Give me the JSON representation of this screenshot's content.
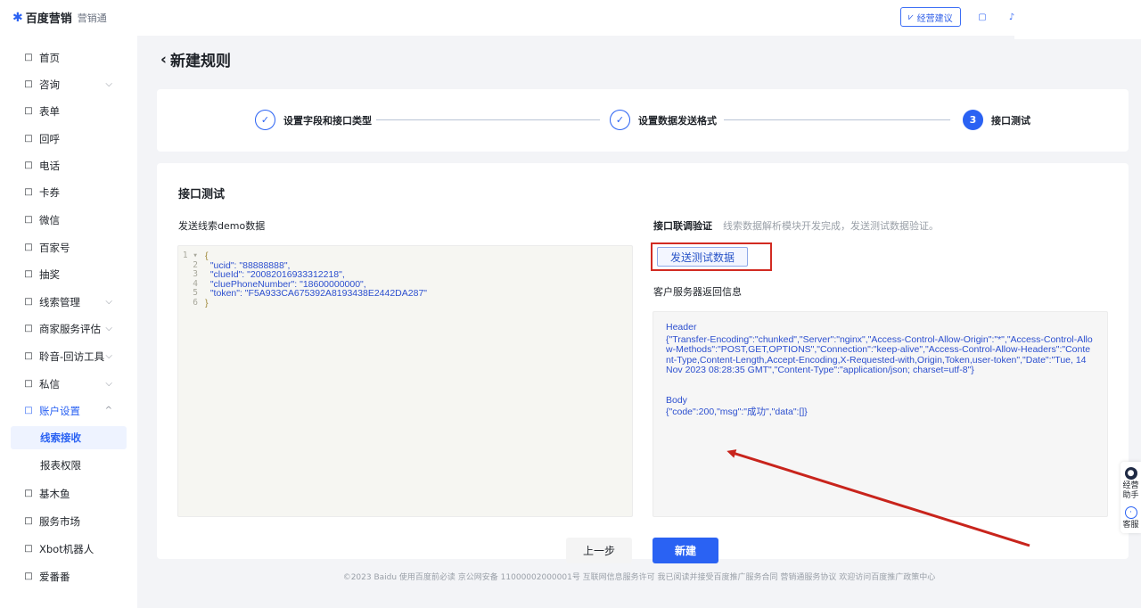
{
  "brand": {
    "logo": "百度营销",
    "product": "营销通"
  },
  "topbar": {
    "advice_label": "经营建议",
    "advice_icon": "chart-icon"
  },
  "sidebar": {
    "items": [
      {
        "label": "首页",
        "icon": "home-icon"
      },
      {
        "label": "咨询",
        "icon": "chat-icon",
        "chevron": "⌵"
      },
      {
        "label": "表单",
        "icon": "form-icon"
      },
      {
        "label": "回呼",
        "icon": "callback-icon"
      },
      {
        "label": "电话",
        "icon": "phone-icon"
      },
      {
        "label": "卡券",
        "icon": "coupon-icon"
      },
      {
        "label": "微信",
        "icon": "wechat-icon"
      },
      {
        "label": "百家号",
        "icon": "baijiahao-icon"
      },
      {
        "label": "抽奖",
        "icon": "gift-icon"
      },
      {
        "label": "线索管理",
        "icon": "chart-icon",
        "chevron": "⌵"
      },
      {
        "label": "商家服务评估",
        "icon": "shield-icon",
        "chevron": "⌵"
      },
      {
        "label": "聆音-回访工具",
        "icon": "headset-icon",
        "chevron": "⌵"
      },
      {
        "label": "私信",
        "icon": "message-icon",
        "chevron": "⌵"
      },
      {
        "label": "账户设置",
        "icon": "settings-icon",
        "chevron": "^"
      }
    ],
    "sub_items": [
      {
        "label": "线索接收"
      },
      {
        "label": "报表权限"
      }
    ],
    "bottom_items": [
      {
        "label": "基木鱼",
        "icon": "fish-icon"
      },
      {
        "label": "服务市场",
        "icon": "market-icon"
      },
      {
        "label": "Xbot机器人",
        "icon": "robot-icon"
      },
      {
        "label": "爱番番",
        "icon": "aifanfan-icon"
      }
    ]
  },
  "page": {
    "back": "‹",
    "title": "新建规则"
  },
  "steps": [
    {
      "label": "设置字段和接口类型",
      "mark": "✓"
    },
    {
      "label": "设置数据发送格式",
      "mark": "✓"
    },
    {
      "label": "接口测试",
      "mark": "3"
    }
  ],
  "test": {
    "section_title": "接口测试",
    "demo_label": "发送线索demo数据",
    "code_lines": [
      {
        "no": "1 ▾",
        "text": "{"
      },
      {
        "no": "2",
        "text": "  \"ucid\": \"88888888\","
      },
      {
        "no": "3",
        "text": "  \"clueId\": \"20082016933312218\","
      },
      {
        "no": "4",
        "text": "  \"cluePhoneNumber\": \"18600000000\","
      },
      {
        "no": "5",
        "text": "  \"token\": \"F5A933CA675392A8193438E2442DA287\""
      },
      {
        "no": "6",
        "text": "}"
      }
    ],
    "verify_label": "接口联调验证",
    "verify_hint": "线索数据解析模块开发完成，发送测试数据验证。",
    "send_button": "发送测试数据",
    "response_label": "客户服务器返回信息",
    "header_title": "Header",
    "header_text": "{\"Transfer-Encoding\":\"chunked\",\"Server\":\"nginx\",\"Access-Control-Allow-Origin\":\"*\",\"Access-Control-Allow-Methods\":\"POST,GET,OPTIONS\",\"Connection\":\"keep-alive\",\"Access-Control-Allow-Headers\":\"Content-Type,Content-Length,Accept-Encoding,X-Requested-with,Origin,Token,user-token\",\"Date\":\"Tue, 14 Nov 2023 08:28:35 GMT\",\"Content-Type\":\"application/json; charset=utf-8\"}",
    "body_title": "Body",
    "body_text": "{\"code\":200,\"msg\":\"成功\",\"data\":[]}"
  },
  "buttons": {
    "prev": "上一步",
    "create": "新建"
  },
  "footer": "©2023  Baidu 使用百度前必读 京公网安备 11000002000001号 互联网信息服务许可 我已阅读并接受百度推广服务合同 营销通服务协议 欢迎访问百度推广政策中心",
  "float": [
    {
      "label1": "经营",
      "label2": "助手",
      "icon": "assistant-icon"
    },
    {
      "label1": "客服",
      "label2": "",
      "icon": "service-icon"
    }
  ],
  "colors": {
    "accent": "#2a62f3",
    "highlight": "#d22b22",
    "arrow": "#c8241c"
  }
}
